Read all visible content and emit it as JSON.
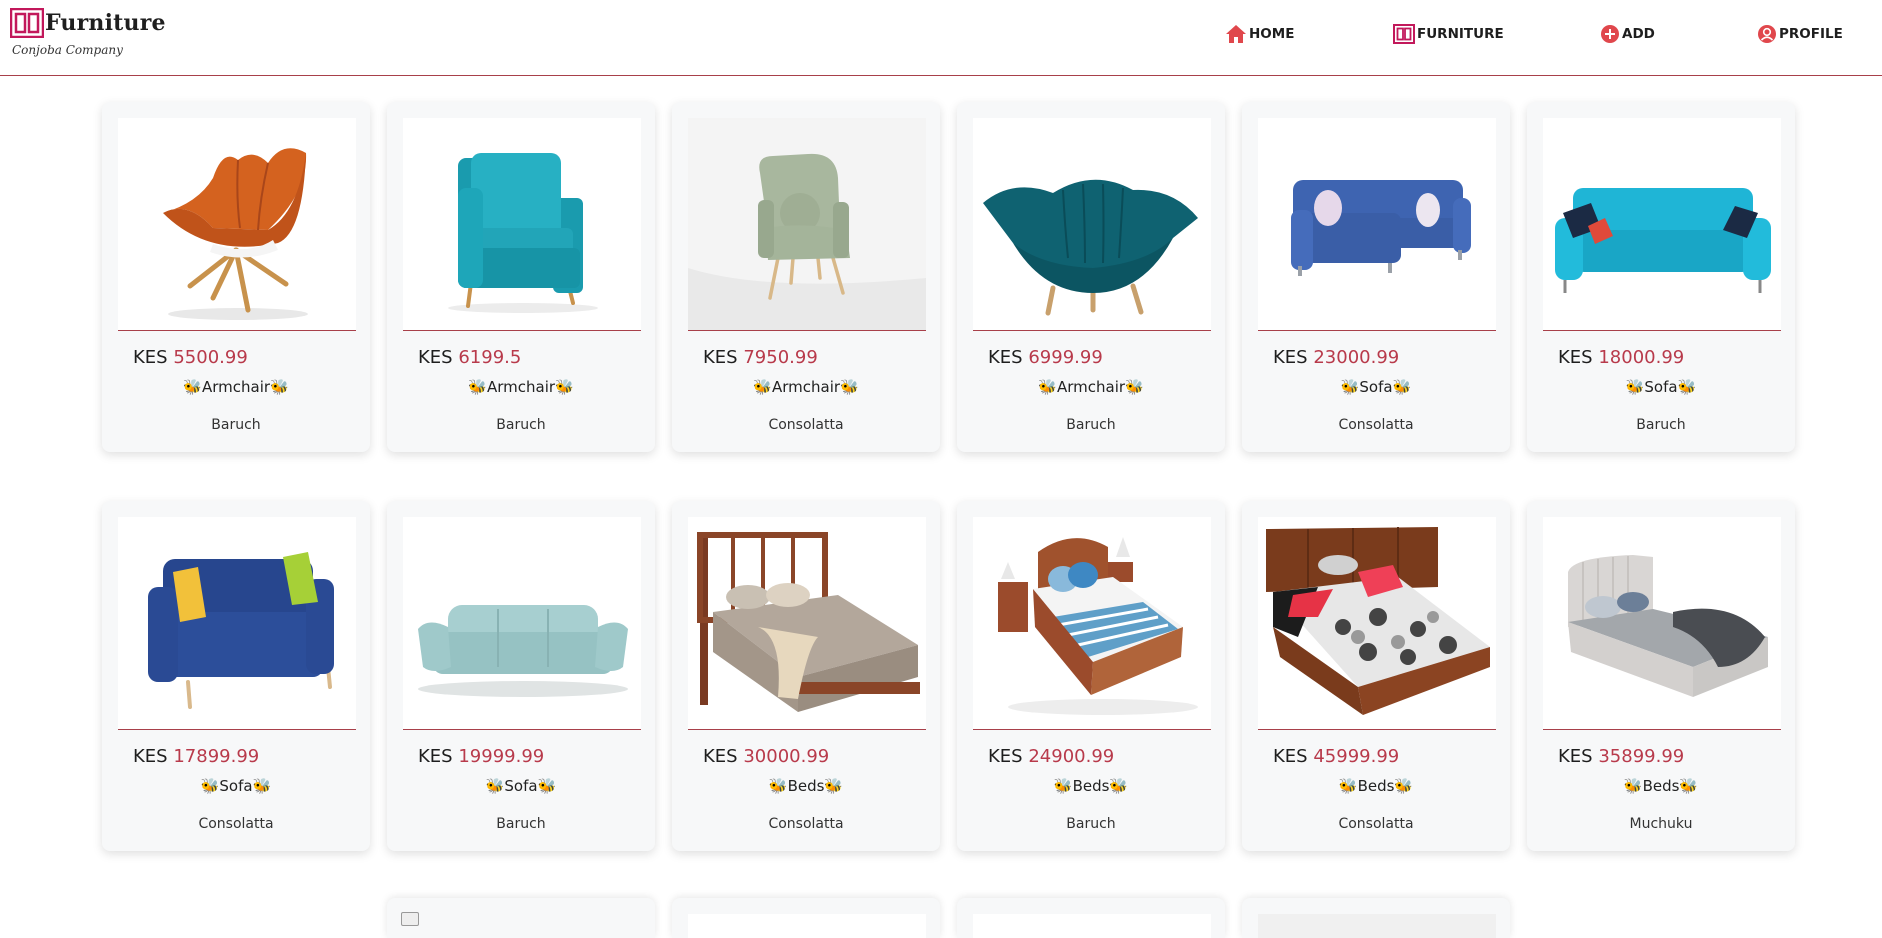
{
  "brand": {
    "name": "Furniture",
    "subtitle": "Conjoba Company"
  },
  "nav": [
    {
      "label": "HOME",
      "icon": "home-icon"
    },
    {
      "label": "FURNITURE",
      "icon": "furniture-icon"
    },
    {
      "label": "ADD",
      "icon": "add-circle-icon"
    },
    {
      "label": "PROFILE",
      "icon": "profile-icon"
    }
  ],
  "colors": {
    "accent": "#b83a4b",
    "logo": "#c2185b",
    "divider": "#a8404a",
    "card_bg": "#f7f8f9"
  },
  "currency": "KES",
  "category_decoration": "bee-emoji",
  "products": [
    {
      "price": "5500.99",
      "category": "Armchair",
      "seller": "Baruch",
      "image": "orange-armchair"
    },
    {
      "price": "6199.5",
      "category": "Armchair",
      "seller": "Baruch",
      "image": "teal-armchair"
    },
    {
      "price": "7950.99",
      "category": "Armchair",
      "seller": "Consolatta",
      "image": "sage-wingback-chair"
    },
    {
      "price": "6999.99",
      "category": "Armchair",
      "seller": "Baruch",
      "image": "teal-channel-chair"
    },
    {
      "price": "23000.99",
      "category": "Sofa",
      "seller": "Consolatta",
      "image": "blue-sectional-sofa"
    },
    {
      "price": "18000.99",
      "category": "Sofa",
      "seller": "Baruch",
      "image": "turquoise-sofa"
    },
    {
      "price": "17899.99",
      "category": "Sofa",
      "seller": "Consolatta",
      "image": "navy-sofa"
    },
    {
      "price": "19999.99",
      "category": "Sofa",
      "seller": "Baruch",
      "image": "mint-sofa"
    },
    {
      "price": "30000.99",
      "category": "Beds",
      "seller": "Consolatta",
      "image": "wood-frame-bed"
    },
    {
      "price": "24900.99",
      "category": "Beds",
      "seller": "Baruch",
      "image": "striped-bed"
    },
    {
      "price": "45999.99",
      "category": "Beds",
      "seller": "Consolatta",
      "image": "polka-dot-bed"
    },
    {
      "price": "35899.99",
      "category": "Beds",
      "seller": "Muchuku",
      "image": "grey-upholstered-bed"
    }
  ]
}
